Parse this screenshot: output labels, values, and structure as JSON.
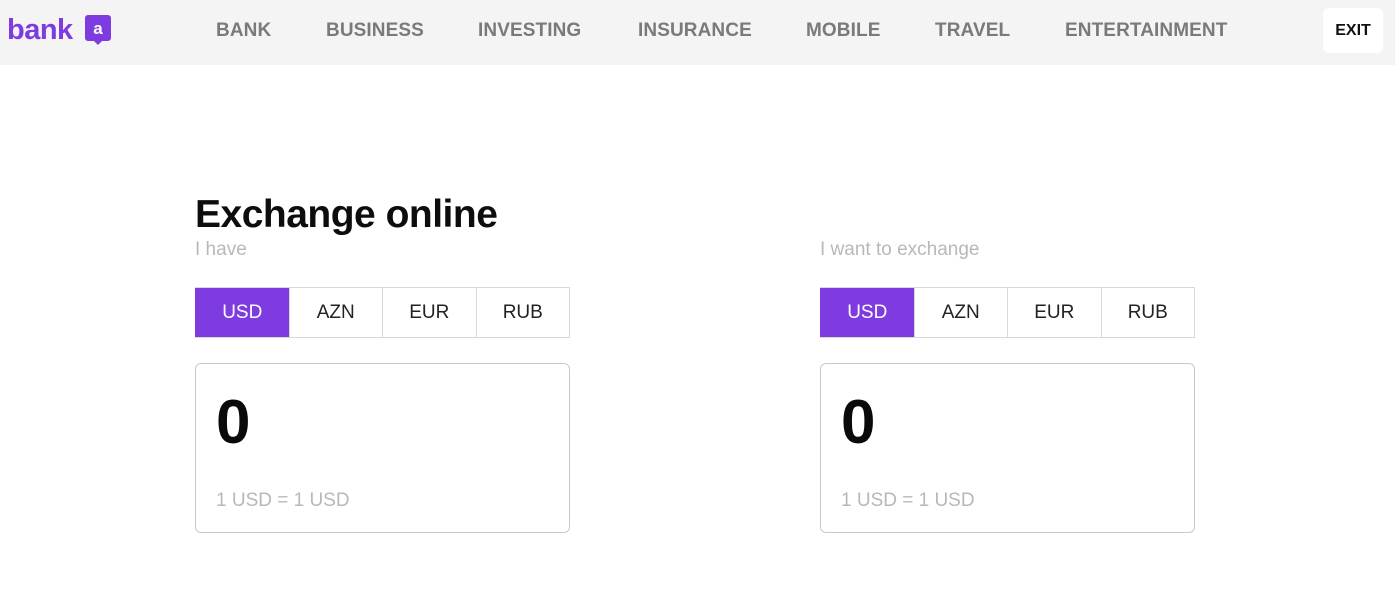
{
  "header": {
    "logo_text": "bank",
    "logo_mark_letter": "a",
    "brand_color": "#7d3be0",
    "nav": [
      "BANK",
      "BUSINESS",
      "INVESTING",
      "INSURANCE",
      "MOBILE",
      "TRAVEL",
      "ENTERTAINMENT"
    ],
    "exit_label": "EXIT"
  },
  "main": {
    "title": "Exchange online",
    "have": {
      "label": "I have",
      "currencies": [
        "USD",
        "AZN",
        "EUR",
        "RUB"
      ],
      "selected": "USD",
      "amount": "0",
      "rate": "1 USD = 1 USD"
    },
    "want": {
      "label": "I want to exchange",
      "currencies": [
        "USD",
        "AZN",
        "EUR",
        "RUB"
      ],
      "selected": "USD",
      "amount": "0",
      "rate": "1 USD = 1 USD"
    }
  }
}
